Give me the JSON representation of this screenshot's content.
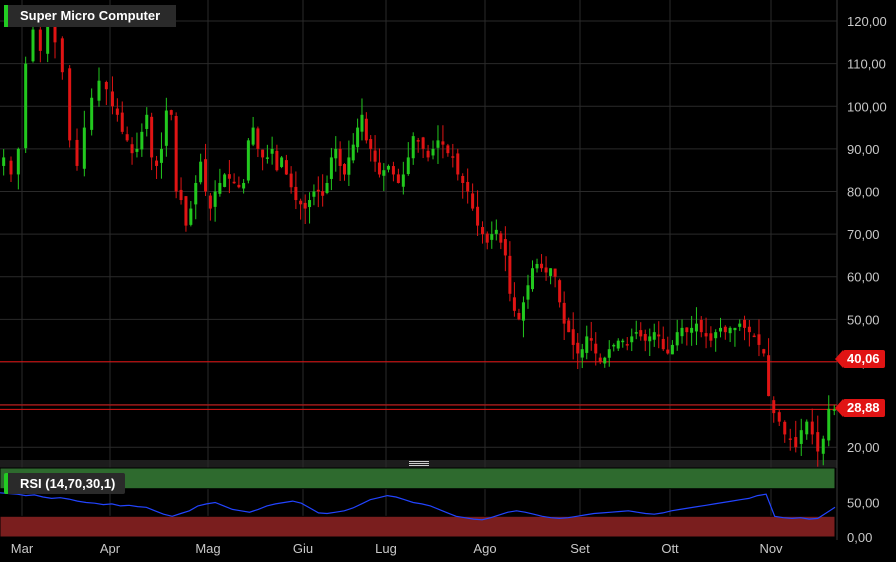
{
  "chart": {
    "title": "Super Micro Computer",
    "indicator_label": "RSI (14,70,30,1)",
    "colors": {
      "up": "#22c81e",
      "down": "#e01414",
      "grid": "#2a2a2a",
      "rsi_line": "#2244ff",
      "overbought": "#2e6a2e",
      "oversold": "#7a1e1e",
      "level_line": "#e01414"
    }
  },
  "chart_data": [
    {
      "type": "candlestick",
      "title": "Super Micro Computer",
      "x_tick_labels": [
        "Mar",
        "Apr",
        "Mag",
        "Giu",
        "Lug",
        "Ago",
        "Set",
        "Ott",
        "Nov"
      ],
      "y_tick_labels": [
        "20,00",
        "30,00",
        "40,00",
        "50,00",
        "60,00",
        "70,00",
        "80,00",
        "90,00",
        "100,00",
        "110,00",
        "120,00"
      ],
      "ylim": [
        17,
        124
      ],
      "grid": true,
      "price_levels": [
        {
          "label": "40,06",
          "value": 40.06
        },
        {
          "label": "28,88",
          "value": 28.88
        },
        {
          "value": 29.9
        }
      ],
      "months": [
        {
          "label": "Mar",
          "closes": [
            88,
            84,
            90,
            110,
            118,
            113,
            120,
            115,
            108,
            92,
            86,
            95,
            102,
            106,
            104
          ]
        },
        {
          "label": "Apr",
          "closes": [
            100,
            98,
            94,
            92,
            89,
            90,
            94,
            98,
            88,
            86,
            90,
            99,
            98,
            80,
            78,
            72,
            76,
            82,
            87,
            80
          ]
        },
        {
          "label": "Mag",
          "closes": [
            76,
            80,
            82,
            84,
            83,
            82,
            81,
            82,
            92,
            95,
            90,
            88,
            88,
            90,
            85,
            88,
            84,
            81,
            78,
            77
          ]
        },
        {
          "label": "Giu",
          "closes": [
            76,
            78,
            80,
            80,
            79,
            82,
            88,
            90,
            86,
            84,
            88,
            91,
            95,
            98,
            92,
            90,
            87,
            84,
            85
          ]
        },
        {
          "label": "Lug",
          "closes": [
            86,
            84,
            82,
            84,
            88,
            93,
            92,
            90,
            88,
            90,
            92,
            91,
            89,
            88,
            84,
            82,
            80,
            76,
            72,
            70
          ]
        },
        {
          "label": "Ago",
          "closes": [
            68,
            70,
            71,
            68,
            65,
            56,
            52,
            50,
            54,
            58,
            62,
            63,
            62,
            61,
            62,
            60,
            54,
            49,
            47,
            44,
            42
          ]
        },
        {
          "label": "Set",
          "closes": [
            43,
            46,
            45,
            42,
            40,
            41,
            43,
            44,
            45,
            45,
            44,
            46,
            47,
            46,
            45,
            46,
            47,
            46,
            43,
            42
          ]
        },
        {
          "label": "Ott",
          "closes": [
            44,
            47,
            48,
            47,
            48,
            49,
            47,
            46,
            45,
            47,
            48,
            47,
            48,
            48,
            49,
            48,
            47,
            46,
            44,
            42,
            32
          ]
        },
        {
          "label": "Nov",
          "closes": [
            28,
            26,
            23,
            22,
            20,
            24,
            26,
            23,
            19,
            22,
            29,
            28.9
          ]
        }
      ]
    },
    {
      "type": "line",
      "title": "RSI (14,70,30,1)",
      "y_tick_labels": [
        "50,00",
        "0,00"
      ],
      "ylim": [
        0,
        100
      ],
      "bands": [
        {
          "name": "overbought",
          "from": 70,
          "to": 100
        },
        {
          "name": "oversold",
          "from": 0,
          "to": 30
        }
      ],
      "values": [
        64,
        63,
        62,
        60,
        61,
        58,
        56,
        57,
        55,
        52,
        50,
        49,
        47,
        48,
        45,
        46,
        44,
        43,
        38,
        33,
        30,
        34,
        38,
        45,
        48,
        50,
        45,
        40,
        38,
        36,
        40,
        45,
        48,
        50,
        52,
        49,
        42,
        35,
        34,
        36,
        38,
        42,
        48,
        54,
        57,
        60,
        58,
        54,
        50,
        48,
        45,
        40,
        35,
        30,
        28,
        26,
        25,
        28,
        32,
        36,
        38,
        36,
        33,
        30,
        28,
        27,
        28,
        30,
        32,
        34,
        35,
        36,
        37,
        38,
        36,
        34,
        33,
        35,
        38,
        40,
        42,
        44,
        46,
        48,
        50,
        52,
        54,
        56,
        60,
        62,
        30,
        28,
        27,
        28,
        26,
        27,
        35,
        43
      ]
    }
  ]
}
